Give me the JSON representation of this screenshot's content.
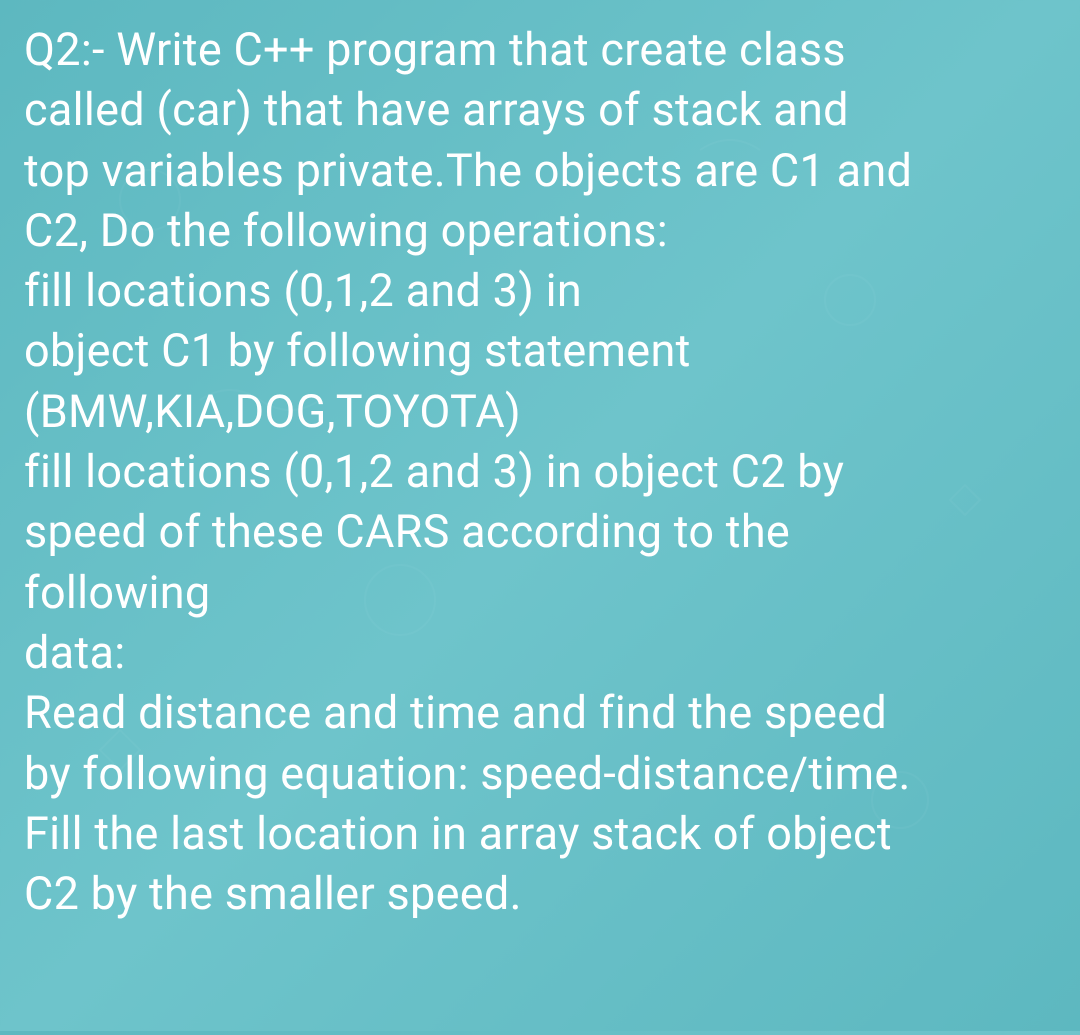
{
  "question": {
    "lines": [
      "Q2:- Write C++ program that create class",
      "called (car) that have arrays of stack and",
      "top variables private.The objects are C1 and",
      "C2, Do the following operations:",
      "fill locations (0,1,2 and 3) in",
      "object C1 by following statement",
      "(BMW,KIA,DOG,TOYOTA)",
      "fill locations (0,1,2 and 3) in object C2 by",
      "speed of these CARS according to the",
      "following",
      "data:",
      "Read distance and time and find the speed",
      "by following equation: speed-distance/time.",
      " Fill the last location in array stack of object",
      "C2 by the smaller speed."
    ]
  }
}
